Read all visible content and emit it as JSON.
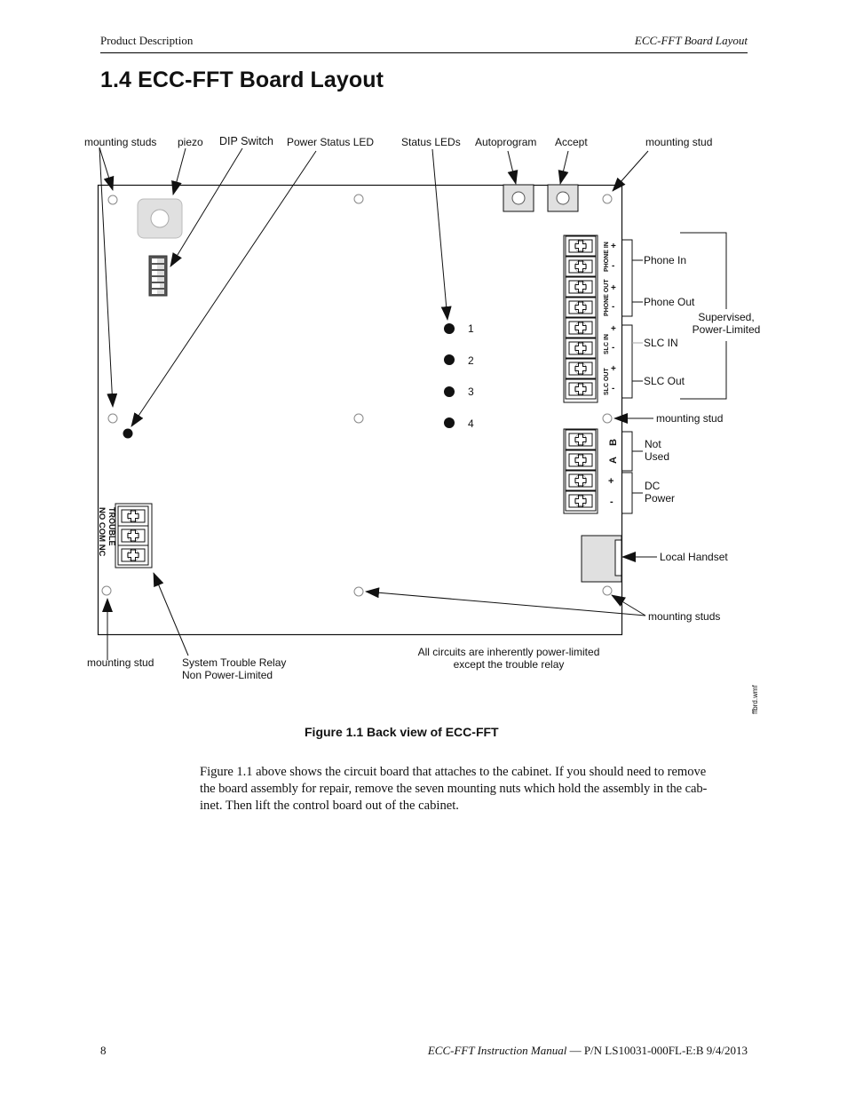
{
  "header": {
    "left": "Product Description",
    "right": "ECC-FFT Board Layout"
  },
  "section": {
    "title": "1.4  ECC-FFT Board Layout"
  },
  "figure": {
    "callouts": {
      "mounting_studs_tl": "mounting studs",
      "piezo": "piezo",
      "dip_switch": "DIP Switch",
      "power_status_led": "Power Status LED",
      "status_leds": "Status LEDs",
      "autoprogram": "Autoprogram",
      "accept": "Accept",
      "mounting_stud_tr": "mounting stud",
      "phone_in": "Phone In",
      "phone_out": "Phone Out",
      "supervised_line1": "Supervised,",
      "supervised_line2": "Power-Limited",
      "slc_in": "SLC IN",
      "slc_out": "SLC Out",
      "mounting_stud_mr": "mounting stud",
      "not_used_line1": "Not",
      "not_used_line2": "Used",
      "dc_power_line1": "DC",
      "dc_power_line2": "Power",
      "local_handset": "Local Handset",
      "mounting_studs_br": "mounting studs",
      "mounting_stud_bl": "mounting stud",
      "trouble_relay_line1": "System Trouble Relay",
      "trouble_relay_line2": "Non Power-Limited",
      "note_line1": "All circuits are inherently power-limited",
      "note_line2": "except the trouble relay",
      "file_name": "ffbrd.wmf"
    },
    "status_led_numbers": [
      "1",
      "2",
      "3",
      "4"
    ],
    "terminal_labels": {
      "phone_in": "PHONE  IN",
      "phone_out": "PHONE  OUT",
      "slc_in": "SLC  IN",
      "slc_out": "SLC  OUT",
      "plus": "+",
      "minus": "-",
      "a": "A",
      "b": "B",
      "trouble": "TROUBLE",
      "trouble_pins": "NO COM NC"
    },
    "colors": {
      "line": "#111111",
      "component_fill": "#e0e0e0",
      "dip_body": "#555555"
    }
  },
  "caption": "Figure 1.1  Back view of ECC-FFT",
  "body": {
    "lines": [
      "Figure 1.1 above shows the circuit board that attaches to the cabinet. If you should need to remove",
      "the board assembly for repair, remove the seven mounting nuts which hold the assembly in the cab-",
      "inet. Then lift the control board out of the cabinet."
    ]
  },
  "footer": {
    "page_number": "8",
    "manual_title": "ECC-FFT Instruction Manual",
    "part_info": " — P/N LS10031-000FL-E:B  9/4/2013"
  }
}
